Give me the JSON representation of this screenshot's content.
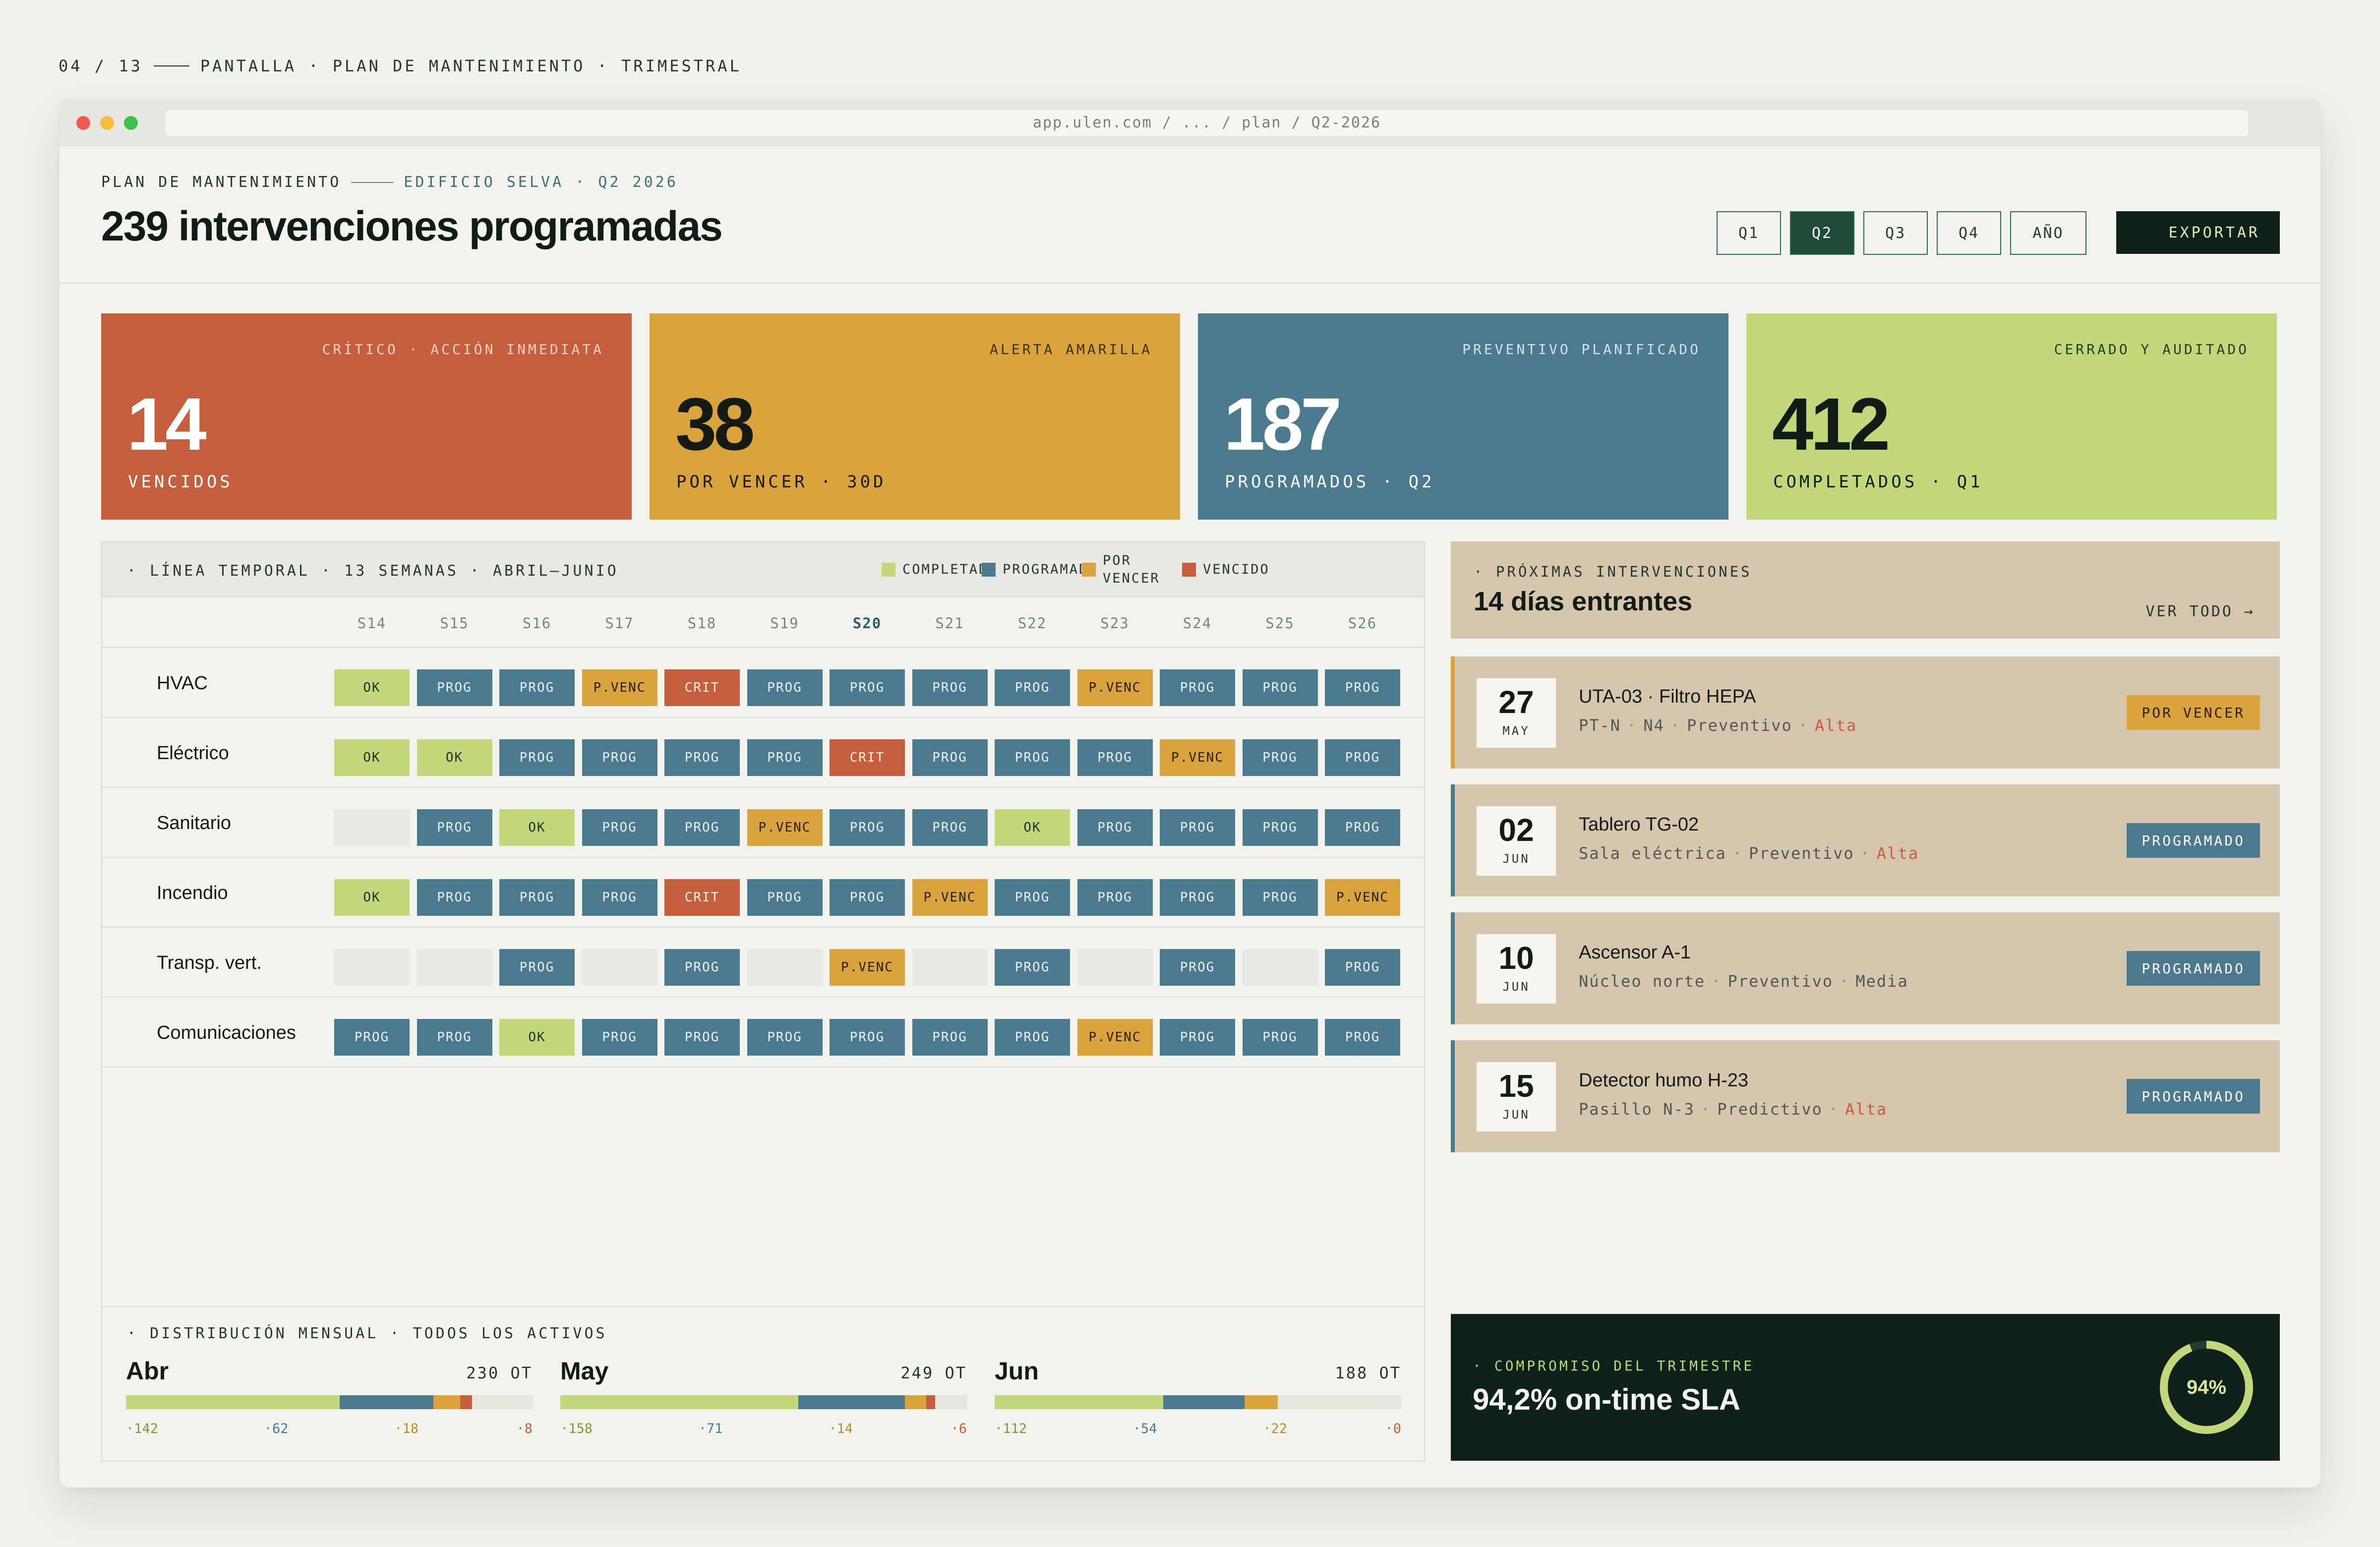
{
  "caption": {
    "counter": "04 / 13",
    "text": "PANTALLA · PLAN DE MANTENIMIENTO · TRIMESTRAL"
  },
  "browser": {
    "url": "app.ulen.com / ... / plan / Q2-2026"
  },
  "header": {
    "eyebrow": "PLAN DE MANTENIMIENTO",
    "eyebrow_sub": "EDIFICIO SELVA · Q2 2026",
    "title": "239 intervenciones programadas",
    "quarters": [
      {
        "label": "Q1",
        "active": false
      },
      {
        "label": "Q2",
        "active": true
      },
      {
        "label": "Q3",
        "active": false
      },
      {
        "label": "Q4",
        "active": false
      },
      {
        "label": "AÑO",
        "active": false
      }
    ],
    "export_label": "EXPORTAR"
  },
  "kpis": [
    {
      "label": "CRÍTICO · ACCIÓN INMEDIATA",
      "value": "14",
      "caption": "VENCIDOS",
      "bg": "#c55e3c",
      "fg": "#ffffff",
      "label_color": "#f3d3c4"
    },
    {
      "label": "ALERTA AMARILLA",
      "value": "38",
      "caption": "POR VENCER · 30D",
      "bg": "#d9a33e",
      "fg": "#151a12",
      "label_color": "#3c3218"
    },
    {
      "label": "PREVENTIVO PLANIFICADO",
      "value": "187",
      "caption": "PROGRAMADOS · Q2",
      "bg": "#4b7a8f",
      "fg": "#ffffff",
      "label_color": "#d3e2e8"
    },
    {
      "label": "CERRADO Y AUDITADO",
      "value": "412",
      "caption": "COMPLETADOS · Q1",
      "bg": "#c3d77b",
      "fg": "#101c15",
      "label_color": "#2a3a22"
    }
  ],
  "timeline": {
    "title": "· LÍNEA TEMPORAL · 13 SEMANAS · ABRIL–JUNIO",
    "legend": [
      {
        "label": "COMPLETADO",
        "color": "#c3d77b"
      },
      {
        "label": "PROGRAMADO",
        "color": "#4b7a8f"
      },
      {
        "label": "POR VENCER",
        "color": "#d9a33e"
      },
      {
        "label": "VENCIDO",
        "color": "#c55e3c"
      }
    ],
    "weeks": [
      "S14",
      "S15",
      "S16",
      "S17",
      "S18",
      "S19",
      "S20",
      "S21",
      "S22",
      "S23",
      "S24",
      "S25",
      "S26"
    ],
    "current_week": "S20",
    "status_labels": {
      "ok": "OK",
      "prog": "PROG",
      "pvenc": "P.VENC",
      "crit": "CRIT",
      "empty": ""
    },
    "rows": [
      {
        "label": "HVAC",
        "cells": [
          "ok",
          "prog",
          "prog",
          "pvenc",
          "crit",
          "prog",
          "prog",
          "prog",
          "prog",
          "pvenc",
          "prog",
          "prog",
          "prog"
        ]
      },
      {
        "label": "Eléctrico",
        "cells": [
          "ok",
          "ok",
          "prog",
          "prog",
          "prog",
          "prog",
          "crit",
          "prog",
          "prog",
          "prog",
          "pvenc",
          "prog",
          "prog"
        ]
      },
      {
        "label": "Sanitario",
        "cells": [
          "empty",
          "prog",
          "ok",
          "prog",
          "prog",
          "pvenc",
          "prog",
          "prog",
          "ok",
          "prog",
          "prog",
          "prog",
          "prog"
        ]
      },
      {
        "label": "Incendio",
        "cells": [
          "ok",
          "prog",
          "prog",
          "prog",
          "crit",
          "prog",
          "prog",
          "pvenc",
          "prog",
          "prog",
          "prog",
          "prog",
          "pvenc"
        ]
      },
      {
        "label": "Transp. vert.",
        "cells": [
          "empty",
          "empty",
          "prog",
          "empty",
          "prog",
          "empty",
          "pvenc",
          "empty",
          "prog",
          "empty",
          "prog",
          "empty",
          "prog"
        ]
      },
      {
        "label": "Comunicaciones",
        "cells": [
          "prog",
          "prog",
          "ok",
          "prog",
          "prog",
          "prog",
          "prog",
          "prog",
          "prog",
          "pvenc",
          "prog",
          "prog",
          "prog"
        ]
      }
    ]
  },
  "monthly": {
    "title": "· DISTRIBUCIÓN MENSUAL · TODOS LOS ACTIVOS",
    "months": [
      {
        "name": "Abr",
        "total": "230 OT",
        "completed": 142,
        "scheduled": 62,
        "due": 18,
        "overdue": 8,
        "labels": [
          "·142",
          "·62",
          "·18",
          "·8"
        ]
      },
      {
        "name": "May",
        "total": "249 OT",
        "completed": 158,
        "scheduled": 71,
        "due": 14,
        "overdue": 6,
        "labels": [
          "·158",
          "·71",
          "·14",
          "·6"
        ]
      },
      {
        "name": "Jun",
        "total": "188 OT",
        "completed": 112,
        "scheduled": 54,
        "due": 22,
        "overdue": 0,
        "labels": [
          "·112",
          "·54",
          "·22",
          "·0"
        ]
      }
    ]
  },
  "upcoming": {
    "eyebrow": "· PRÓXIMAS INTERVENCIONES",
    "title": "14 días entrantes",
    "view_all": "VER TODO →",
    "items": [
      {
        "day": "27",
        "month": "MAY",
        "title": "UTA-03 · Filtro HEPA",
        "location": "PT-N",
        "sub": "N4",
        "type": "Preventivo",
        "priority": "Alta",
        "priority_high": true,
        "status": "POR VENCER",
        "status_bg": "#d9a33e",
        "status_fg": "#2a2010",
        "accent": "#d9a33e"
      },
      {
        "day": "02",
        "month": "JUN",
        "title": "Tablero TG-02",
        "location": "Sala eléctrica",
        "sub": "",
        "type": "Preventivo",
        "priority": "Alta",
        "priority_high": true,
        "status": "PROGRAMADO",
        "status_bg": "#4b7a8f",
        "status_fg": "#ffffff",
        "accent": "#4b7a8f"
      },
      {
        "day": "10",
        "month": "JUN",
        "title": "Ascensor A-1",
        "location": "Núcleo norte",
        "sub": "",
        "type": "Preventivo",
        "priority": "Media",
        "priority_high": false,
        "status": "PROGRAMADO",
        "status_bg": "#4b7a8f",
        "status_fg": "#ffffff",
        "accent": "#4b7a8f"
      },
      {
        "day": "15",
        "month": "JUN",
        "title": "Detector humo H-23",
        "location": "Pasillo N-3",
        "sub": "",
        "type": "Predictivo",
        "priority": "Alta",
        "priority_high": true,
        "status": "PROGRAMADO",
        "status_bg": "#4b7a8f",
        "status_fg": "#ffffff",
        "accent": "#4b7a8f"
      }
    ]
  },
  "sla": {
    "eyebrow": "· COMPROMISO DEL TRIMESTRE",
    "title": "94,2% on-time SLA",
    "percent": 94,
    "percent_label": "94%"
  },
  "colors": {
    "ok": "#c3d77b",
    "prog": "#4b7a8f",
    "pvenc": "#d9a33e",
    "crit": "#c55e3c",
    "dark": "#10201a",
    "sand": "#d6c6ad"
  }
}
